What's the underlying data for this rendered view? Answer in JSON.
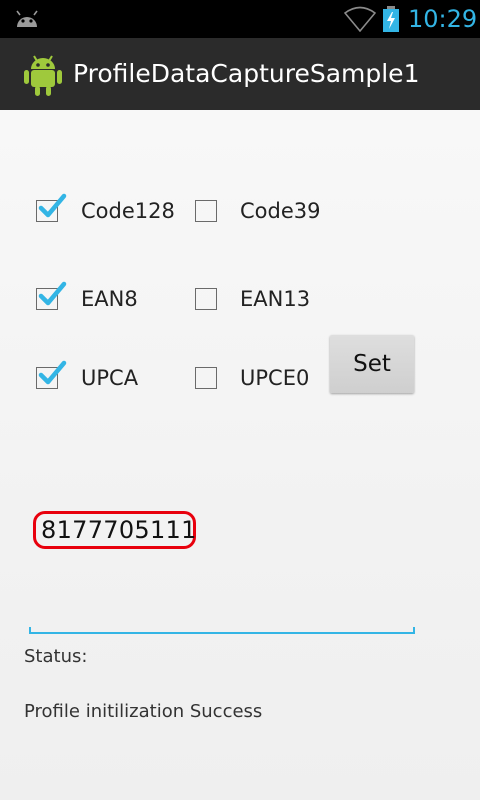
{
  "status_bar": {
    "time": "10:29",
    "icons": [
      "android-debug-icon",
      "wifi-icon",
      "battery-charging-icon"
    ],
    "accent_color": "#33b5e5"
  },
  "action_bar": {
    "title": "ProfileDataCaptureSample1",
    "icon": "android-robot-icon"
  },
  "symbologies": [
    {
      "label": "Code128",
      "checked": true
    },
    {
      "label": "Code39",
      "checked": false
    },
    {
      "label": "EAN8",
      "checked": true
    },
    {
      "label": "EAN13",
      "checked": false
    },
    {
      "label": "UPCA",
      "checked": true
    },
    {
      "label": "UPCE0",
      "checked": false
    }
  ],
  "set_button": {
    "label": "Set"
  },
  "scan_result": {
    "value": "8177705111",
    "highlight_color": "#e8000d"
  },
  "status": {
    "label": "Status:",
    "message": "Profile initilization Success"
  }
}
